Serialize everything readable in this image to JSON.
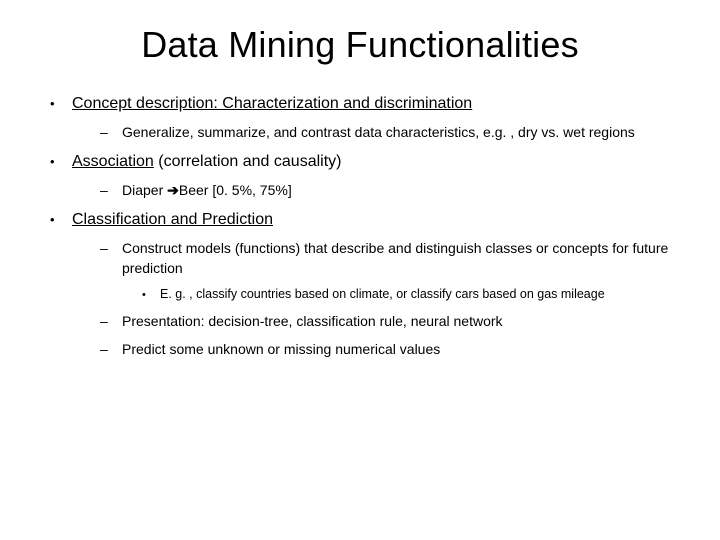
{
  "title": "Data Mining Functionalities",
  "items": [
    {
      "heading_pre": "Concept description: Characterization and discrimination",
      "heading_post": "",
      "subs": [
        {
          "text": "Generalize, summarize, and contrast data characteristics, e.g. , dry vs. wet regions"
        }
      ]
    },
    {
      "heading_pre": "Association",
      "heading_post": " (correlation and causality)",
      "subs": [
        {
          "text_pre": "Diaper ",
          "arrow": "➔",
          "text_post": "Beer [0. 5%, 75%]"
        }
      ]
    },
    {
      "heading_pre": "Classification and Prediction",
      "heading_post": "",
      "subs": [
        {
          "text": "Construct models (functions) that describe and distinguish classes or concepts for future prediction",
          "subsubs": [
            {
              "text": "E. g. , classify countries based on climate, or classify cars based on gas mileage"
            }
          ]
        },
        {
          "text": "Presentation: decision-tree, classification rule, neural network"
        },
        {
          "text": "Predict some unknown or missing numerical values"
        }
      ]
    }
  ]
}
